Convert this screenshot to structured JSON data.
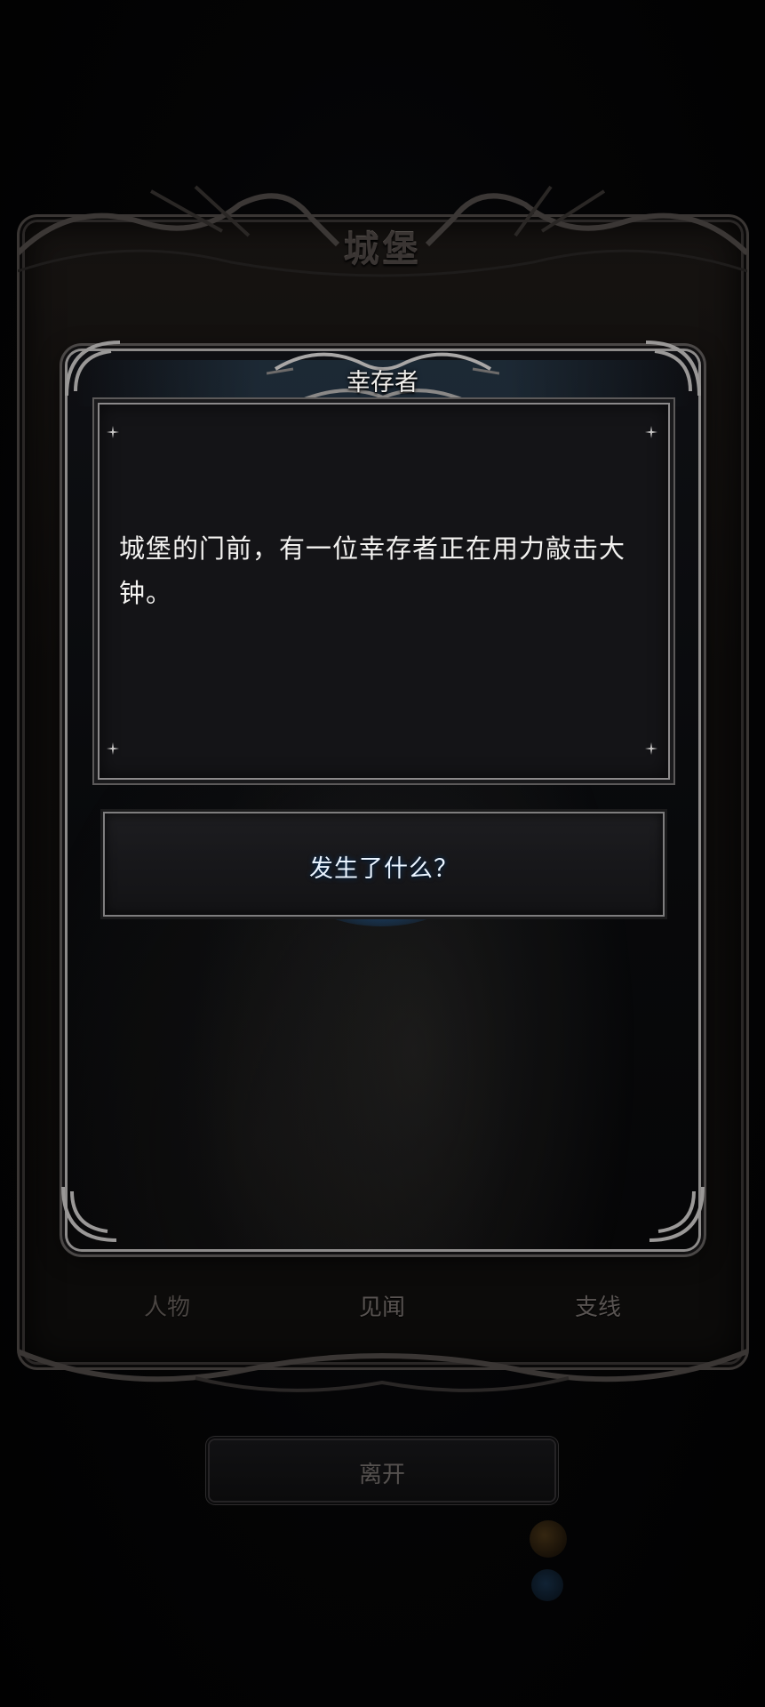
{
  "location": {
    "title": "城堡"
  },
  "event": {
    "title": "幸存者",
    "description": "城堡的门前，有一位幸存者正在用力敲击大钟。"
  },
  "choices": [
    {
      "label": "发生了什么？"
    }
  ],
  "tabs": [
    {
      "label": "人物"
    },
    {
      "label": "见闻"
    },
    {
      "label": "支线"
    }
  ],
  "leave": {
    "label": "离开"
  },
  "colors": {
    "choice_glow": "#3caaff",
    "dialog_frame": "#8d8b8a",
    "description_bg": "#141417"
  }
}
